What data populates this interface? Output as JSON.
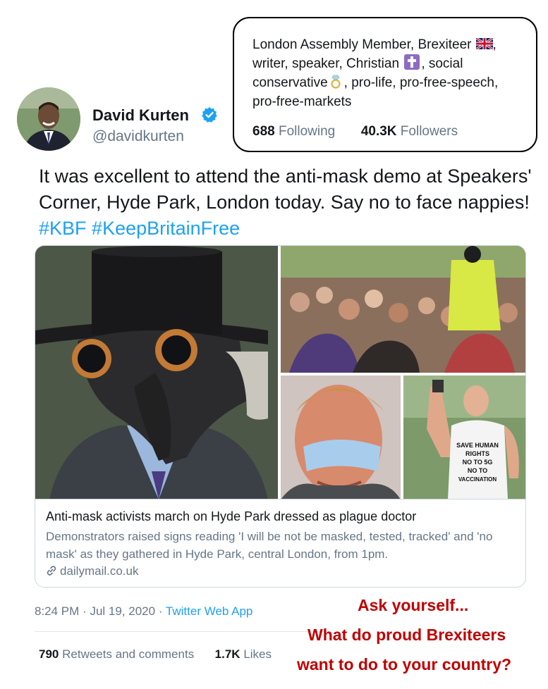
{
  "profile": {
    "name": "David Kurten",
    "handle": "@davidkurten",
    "bio_part1": "London Assembly Member, Brexiteer",
    "bio_part2": ", writer, speaker, Christian",
    "bio_part3": ", social conservative",
    "bio_part4": ", pro-life, pro-free-speech, pro-free-markets",
    "following_count": "688",
    "following_label": "Following",
    "followers_count": "40.3K",
    "followers_label": "Followers"
  },
  "tweet": {
    "text": "It was excellent to attend the anti-mask demo at Speakers' Corner, Hyde Park, London today. Say no to face nappies!",
    "hashtag1": "#KBF",
    "hashtag2": "#KeepBritainFree"
  },
  "card": {
    "title": "Anti-mask activists march on Hyde Park dressed as plague doctor",
    "description": "Demonstrators raised signs reading 'I will be not be masked, tested, tracked' and 'no mask' as they gathered in Hyde Park, central London, from 1pm.",
    "domain": "dailymail.co.uk",
    "sign_text": [
      "SAVE HUMAN",
      "RIGHTS",
      "NO TO 5G",
      "NO TO",
      "VACCINATION"
    ]
  },
  "meta": {
    "time": "8:24 PM",
    "date": "Jul 19, 2020",
    "source": "Twitter Web App",
    "sep": "·"
  },
  "engagement": {
    "retweets_count": "790",
    "retweets_label": "Retweets and comments",
    "likes_count": "1.7K",
    "likes_label": "Likes"
  },
  "caption": {
    "line1": "Ask yourself...",
    "line2": "What do proud Brexiteers",
    "line3": "want to do to your country?"
  },
  "colors": {
    "link_blue": "#1da1f2",
    "muted_gray": "#657786",
    "caption_red": "#c00000"
  }
}
